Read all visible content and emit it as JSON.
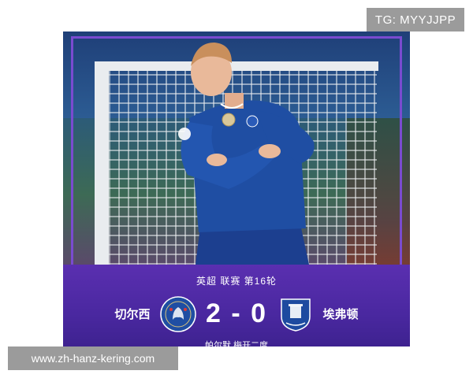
{
  "watermark": {
    "tg": "TG: MYYJJPP",
    "site": "www.zh-hanz-kering.com"
  },
  "match": {
    "competition": "英超 联赛 第16轮",
    "home": {
      "name": "切尔西",
      "crest_icon": "chelsea-crest-icon"
    },
    "away": {
      "name": "埃弗顿",
      "crest_icon": "everton-crest-icon"
    },
    "score": "2 - 0",
    "scorer_line": "帕尔默 梅开二度"
  },
  "colors": {
    "band_purple": "#4a28a0",
    "frame_purple": "#7a4bd0",
    "chelsea_blue": "#1f4ea3",
    "everton_blue": "#1d4aa0",
    "watermark_gray": "#9b9b9b"
  }
}
